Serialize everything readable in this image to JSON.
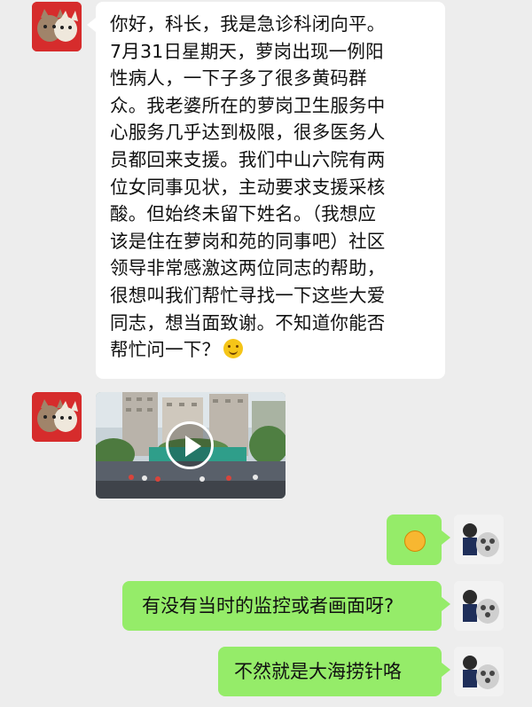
{
  "messages": [
    {
      "side": "left",
      "type": "text",
      "sender_avatar": "cat-avatar",
      "text": "你好，科长，我是急诊科闭向平。\n7月31日星期天，萝岗出现一例阳\n性病人，一下子多了很多黄码群\n众。我老婆所在的萝岗卫生服务中\n心服务几乎达到极限，很多医务人\n员都回来支援。我们中山六院有两\n位女同事见状，主动要求支援采核\n酸。但始终未留下姓名。（我想应\n该是住在萝岗和苑的同事吧）社区\n领导非常感激这两位同志的帮助，\n很想叫我们帮忙寻找一下这些大爱\n同志，想当面致谢。不知道你能否\n帮忙问一下？",
      "emoji": "smile-icon"
    },
    {
      "side": "left",
      "type": "video",
      "sender_avatar": "cat-avatar"
    },
    {
      "side": "right",
      "type": "sticker",
      "sender_avatar": "child-avatar",
      "sticker": "fist-bump-icon"
    },
    {
      "side": "right",
      "type": "text",
      "sender_avatar": "child-avatar",
      "text": "有没有当时的监控或者画面呀?"
    },
    {
      "side": "right",
      "type": "text",
      "sender_avatar": "child-avatar",
      "text": "不然就是大海捞针咯"
    }
  ],
  "colors": {
    "background": "#ededed",
    "incoming_bubble": "#ffffff",
    "outgoing_bubble": "#95ec69"
  }
}
